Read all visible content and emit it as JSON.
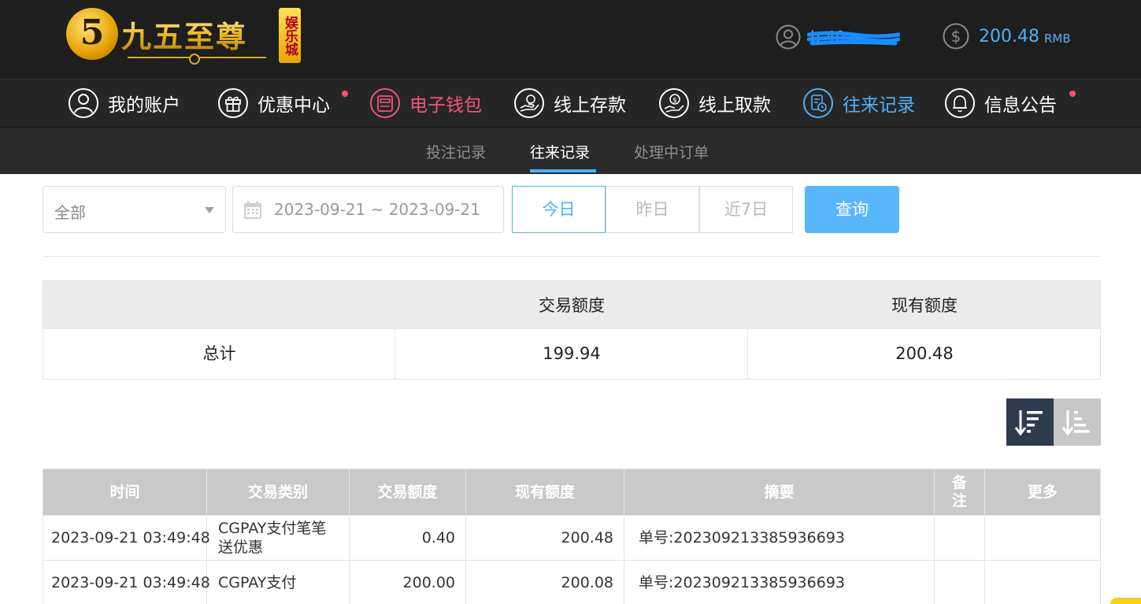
{
  "header": {
    "logo_text": "九五至尊",
    "logo_badge": "5",
    "logo_side": "娱乐城",
    "username": "b   40",
    "balance": "200.48",
    "currency": "RMB"
  },
  "nav": {
    "items": [
      {
        "label": "我的账户",
        "icon": "user-circle-icon"
      },
      {
        "label": "优惠中心",
        "icon": "gift-icon"
      },
      {
        "label": "电子钱包",
        "icon": "wallet-icon"
      },
      {
        "label": "线上存款",
        "icon": "deposit-icon"
      },
      {
        "label": "线上取款",
        "icon": "withdraw-icon"
      },
      {
        "label": "往来记录",
        "icon": "records-icon"
      },
      {
        "label": "信息公告",
        "icon": "bell-icon"
      }
    ],
    "active": "往来记录",
    "highlight": "电子钱包"
  },
  "subnav": {
    "items": [
      "投注记录",
      "往来记录",
      "处理中订单"
    ],
    "active": "往来记录"
  },
  "filters": {
    "type_value": "全部",
    "date_range": "2023-09-21 ~ 2023-09-21",
    "quick": [
      "今日",
      "昨日",
      "近7日"
    ],
    "quick_active": "今日",
    "search_label": "查询"
  },
  "summary": {
    "headers": [
      "",
      "交易额度",
      "现有额度"
    ],
    "row_label": "总计",
    "transaction_total": "199.94",
    "current_total": "200.48"
  },
  "table": {
    "headers": [
      "时间",
      "交易类别",
      "交易额度",
      "现有额度",
      "摘要",
      "备注",
      "更多"
    ],
    "rows": [
      {
        "time": "2023-09-21 03:49:48",
        "type": "CGPAY支付笔笔送优惠",
        "amount": "0.40",
        "balance": "200.48",
        "memo": "单号:202309213385936693",
        "note": "",
        "more": ""
      },
      {
        "time": "2023-09-21 03:49:48",
        "type": "CGPAY支付",
        "amount": "200.00",
        "balance": "200.08",
        "memo": "单号:202309213385936693",
        "note": "",
        "more": ""
      }
    ]
  },
  "colors": {
    "accent": "#4fb1f5",
    "highlight": "#f0557a",
    "header_bg": "#1e1e1e",
    "search_button": "#58b7fa"
  }
}
